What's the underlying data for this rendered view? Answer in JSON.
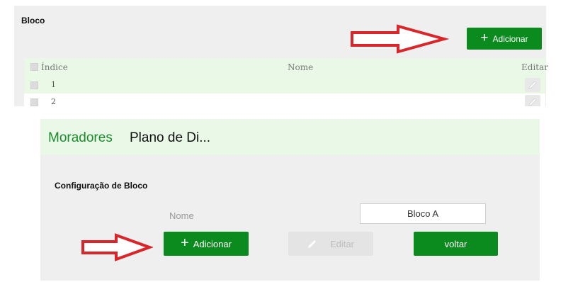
{
  "top": {
    "section_title": "Bloco",
    "add_button": {
      "label": "Adicionar",
      "icon": "plus-icon"
    },
    "table": {
      "columns": [
        "Índice",
        "Nome",
        "Editar"
      ],
      "rows": [
        {
          "index": "1",
          "name": ""
        },
        {
          "index": "2",
          "name": ""
        }
      ]
    }
  },
  "bottom": {
    "tabs": [
      {
        "label": "Moradores",
        "active": true
      },
      {
        "label": "Plano de Di...",
        "active": false
      }
    ],
    "section_title": "Configuração de Bloco",
    "name_field": {
      "label": "Nome",
      "value": "Bloco A"
    },
    "buttons": {
      "add": {
        "label": "Adicionar",
        "icon": "plus-icon"
      },
      "edit": {
        "label": "Editar",
        "icon": "pencil-icon",
        "disabled": true
      },
      "back": {
        "label": "voltar"
      }
    }
  },
  "colors": {
    "accent_green": "#0b8a1e",
    "tab_green": "#1e8a2e",
    "header_bg": "#e9f8e7",
    "panel_bg": "#efefef",
    "annotation_arrow": "#d9262a"
  }
}
